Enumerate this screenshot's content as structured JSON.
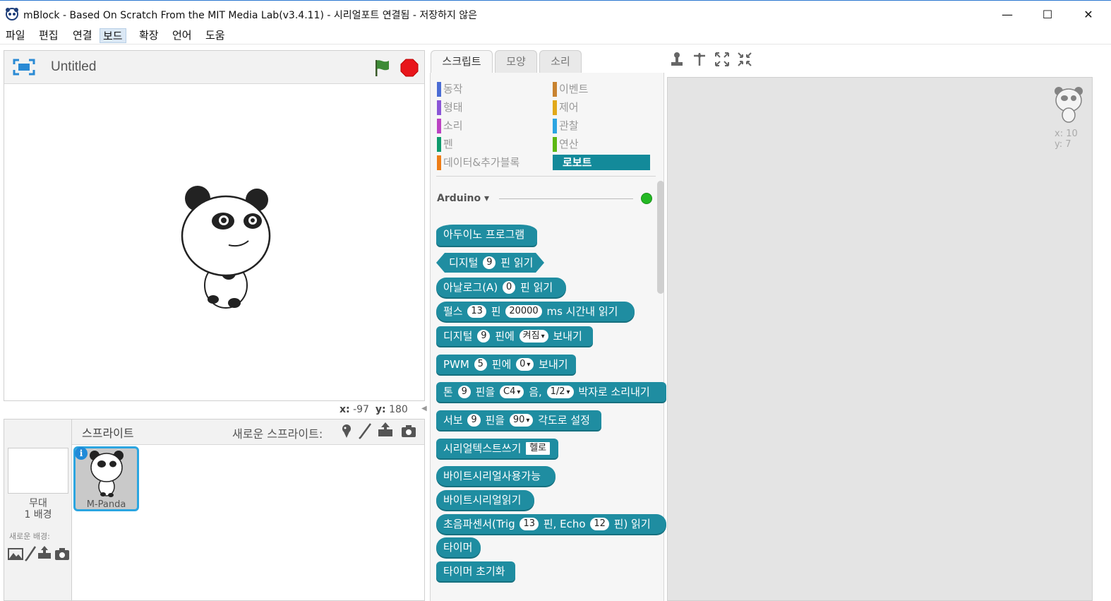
{
  "window": {
    "title": "mBlock - Based On Scratch From the MIT Media Lab(v3.4.11) - 시리얼포트 연결됨 - 저장하지 않은",
    "minimize": "—",
    "maximize": "☐",
    "close": "✕"
  },
  "menu": [
    "파일",
    "편집",
    "연결",
    "보드",
    "확장",
    "언어",
    "도움"
  ],
  "stage": {
    "project_title": "Untitled",
    "x_label": "x:",
    "x_value": "-97",
    "y_label": "y:",
    "y_value": "180"
  },
  "sprites": {
    "title": "스프라이트",
    "new_sprite_label": "새로운 스프라이트:",
    "stage_label_line1": "무대",
    "stage_label_line2": "1 배경",
    "new_backdrop_label": "새로운 배경:",
    "items": [
      {
        "name": "M-Panda",
        "selected": true
      }
    ],
    "info_glyph": "i"
  },
  "tabs": [
    {
      "label": "스크립트",
      "active": true
    },
    {
      "label": "모양",
      "active": false
    },
    {
      "label": "소리",
      "active": false
    }
  ],
  "categories": [
    {
      "label": "동작",
      "color": "#4a6cd4"
    },
    {
      "label": "형태",
      "color": "#8a55d7"
    },
    {
      "label": "소리",
      "color": "#bb42c3"
    },
    {
      "label": "펜",
      "color": "#0e9a6c"
    },
    {
      "label": "데이터&추가블록",
      "color": "#ee7d16"
    },
    {
      "label": "이벤트",
      "color": "#c88330"
    },
    {
      "label": "제어",
      "color": "#e1a91a"
    },
    {
      "label": "관찰",
      "color": "#2ca5e2"
    },
    {
      "label": "연산",
      "color": "#5cb712"
    },
    {
      "label": "로보트",
      "color": "#138a9a",
      "active": true
    }
  ],
  "extension": {
    "name": "Arduino",
    "arrow": "▾",
    "connected_color": "#23b823"
  },
  "blocks": {
    "b1": {
      "text": "아두이노 프로그램"
    },
    "b2": {
      "pre": "디지털",
      "v1": "9",
      "post": "핀 읽기"
    },
    "b3": {
      "pre": "아날로그(A)",
      "v1": "0",
      "post": "핀 읽기"
    },
    "b4": {
      "pre": "펄스",
      "v1": "13",
      "mid": "핀",
      "v2": "20000",
      "post": "ms 시간내 읽기"
    },
    "b5": {
      "pre": "디지털",
      "v1": "9",
      "mid": "핀에",
      "v2": "켜짐",
      "post": "보내기"
    },
    "b6": {
      "pre": "PWM",
      "v1": "5",
      "mid": "핀에",
      "v2": "0",
      "post": "보내기"
    },
    "b7": {
      "pre": "톤",
      "v1": "9",
      "mid": "핀을",
      "v2": "C4",
      "mid2": "음,",
      "v3": "1/2",
      "post": "박자로 소리내기"
    },
    "b8": {
      "pre": "서보",
      "v1": "9",
      "mid": "핀을",
      "v2": "90",
      "post": "각도로 설정"
    },
    "b9": {
      "pre": "시리얼텍스트쓰기",
      "v1": "헬로"
    },
    "b10": {
      "text": "바이트시리얼사용가능"
    },
    "b11": {
      "text": "바이트시리얼읽기"
    },
    "b12": {
      "pre": "초음파센서(Trig",
      "v1": "13",
      "mid": "핀, Echo",
      "v2": "12",
      "post": "핀) 읽기"
    },
    "b13": {
      "text": "타이머"
    },
    "b14": {
      "text": "타이머 초기화"
    }
  },
  "script_area": {
    "x_label": "x: 10",
    "y_label": "y: 7"
  },
  "colors": {
    "block": "#1f8da1",
    "selected_sprite_border": "#2ba5e0",
    "stop": "#e8151b",
    "flag": "#3d8b36"
  }
}
